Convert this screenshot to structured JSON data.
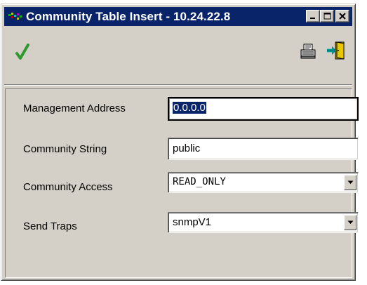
{
  "window": {
    "title": "Community Table Insert - 10.24.22.8"
  },
  "titlebar_buttons": [
    "minimize-button",
    "maximize-button",
    "close-button"
  ],
  "toolbar": {
    "apply_icon": "checkmark-icon",
    "print_icon": "printer-icon",
    "exit_icon": "exit-door-icon"
  },
  "form": {
    "management_address": {
      "label": "Management Address",
      "value": "0.0.0.0"
    },
    "community_string": {
      "label": "Community String",
      "value": "public"
    },
    "community_access": {
      "label": "Community Access",
      "value": "READ_ONLY"
    },
    "send_traps": {
      "label": "Send Traps",
      "value": "snmpV1"
    }
  },
  "colors": {
    "titlebar": "#0a246a",
    "face": "#d4d0c8",
    "checkmark": "#2e9a2e"
  }
}
